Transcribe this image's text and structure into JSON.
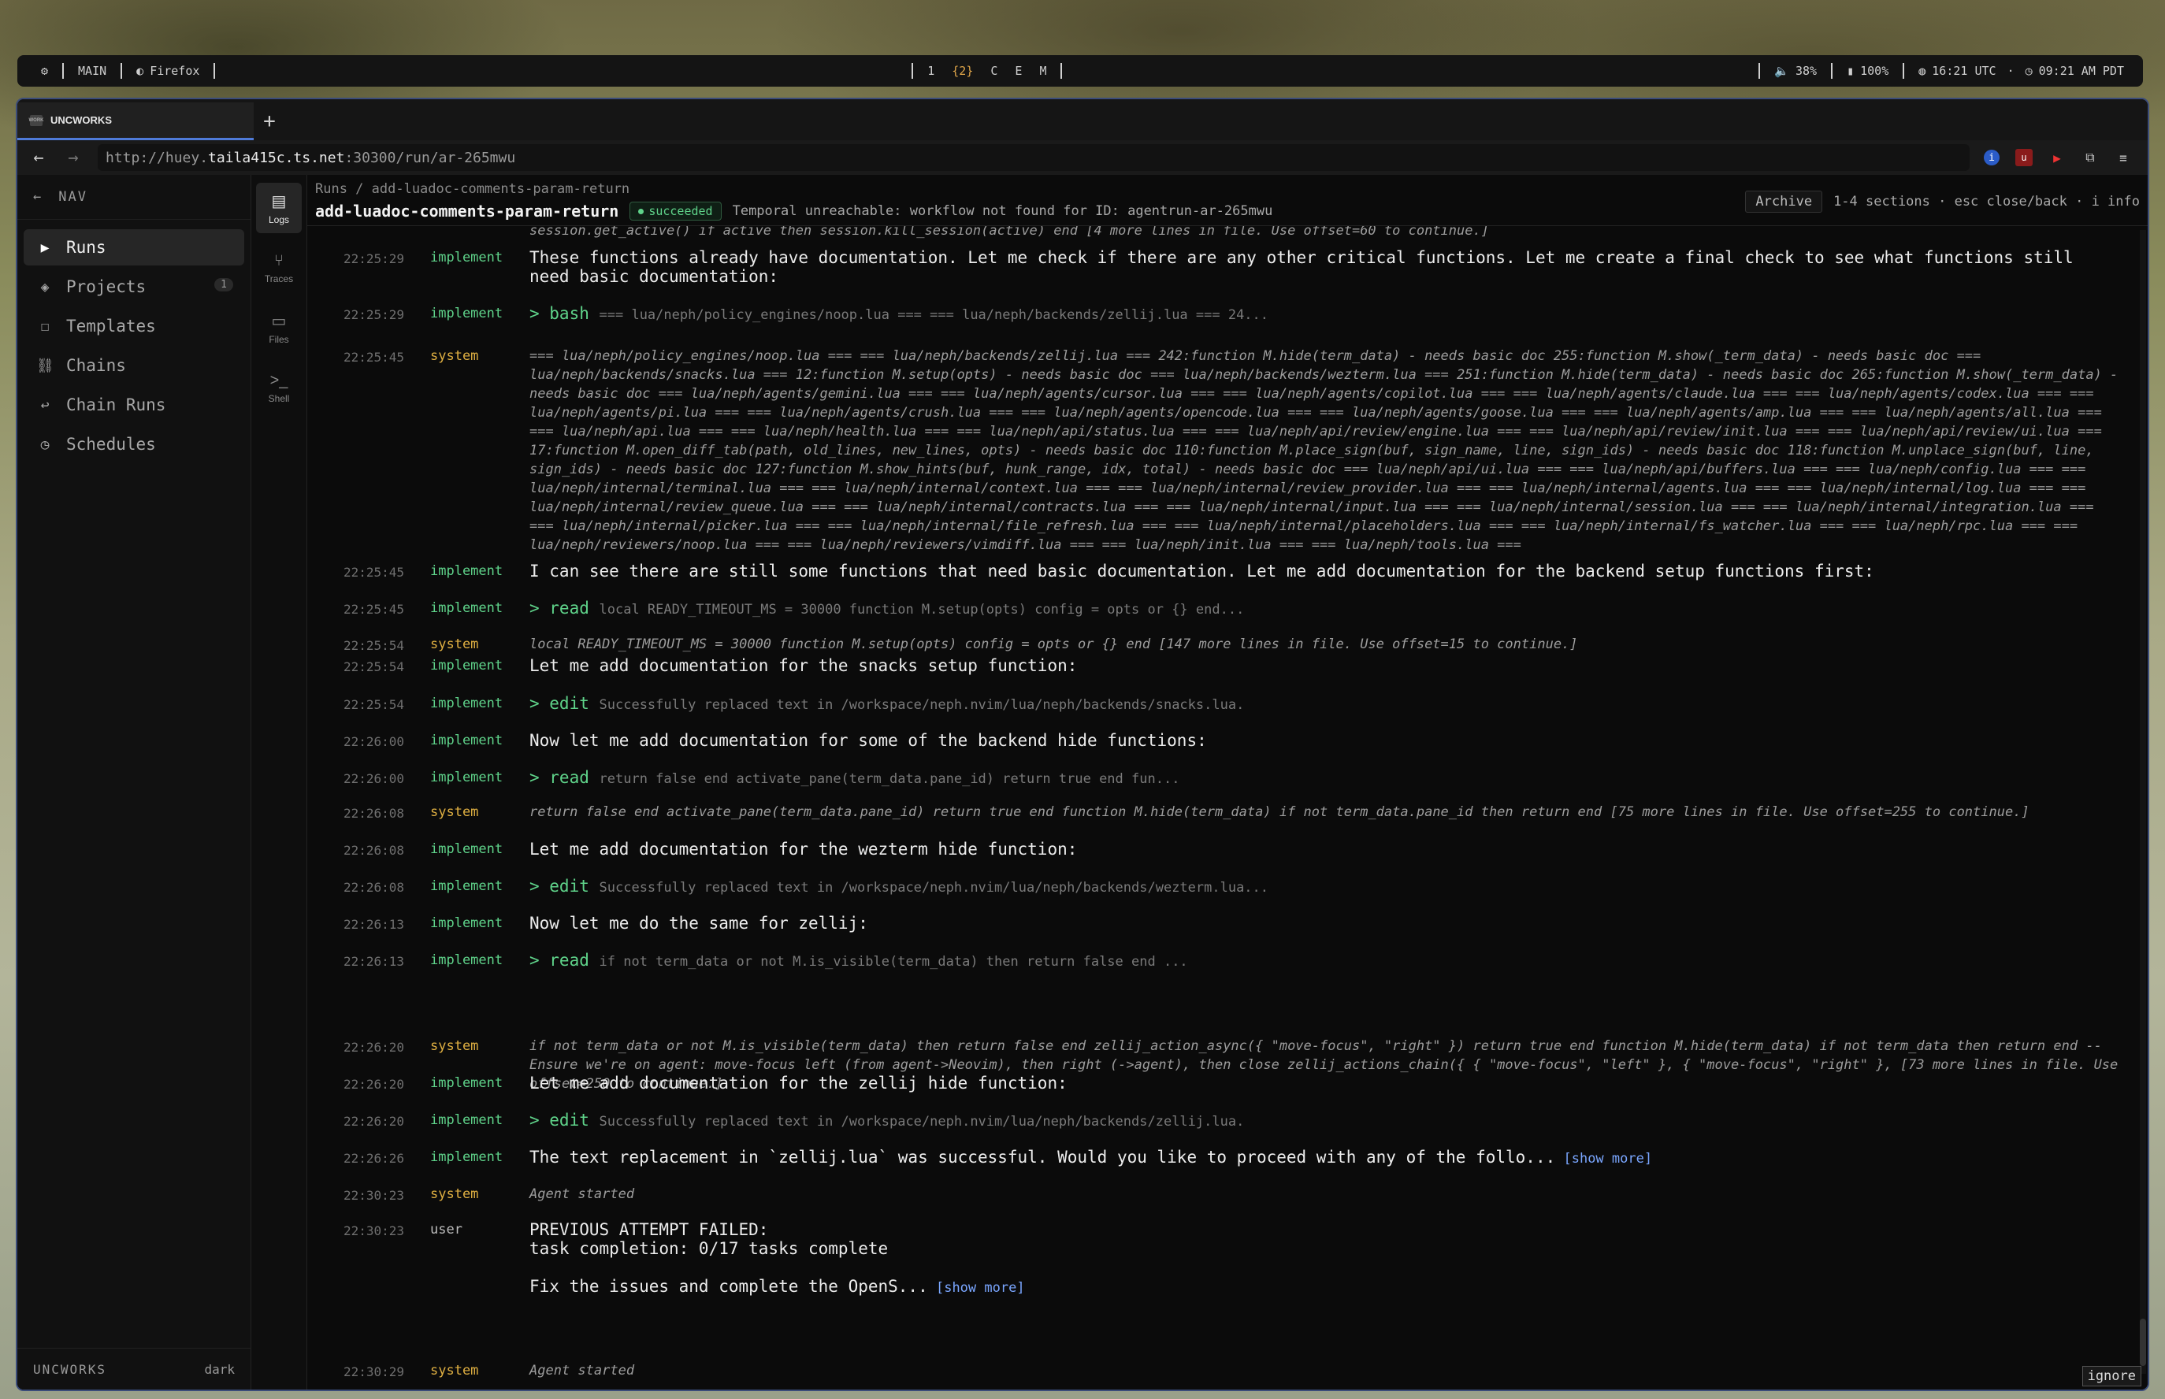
{
  "topbar": {
    "main": "MAIN",
    "browser": "Firefox",
    "workspaces": [
      "1",
      "{2}",
      "C",
      "E",
      "M"
    ],
    "volume": "38%",
    "battery": "100%",
    "utc_time": "16:21 UTC",
    "local_time": "09:21 AM PDT"
  },
  "browser": {
    "tab_title": "UNCWORKS",
    "favicon_text": "WORK",
    "new_tab": "+",
    "url_prefix": "http://huey.",
    "url_host": "taila415c.ts.net",
    "url_path": ":30300/run/ar-265mwu"
  },
  "sidebar": {
    "header": "NAV",
    "items": [
      {
        "label": "Runs",
        "icon": "play-icon",
        "active": true
      },
      {
        "label": "Projects",
        "icon": "diamond-icon",
        "badge": "1"
      },
      {
        "label": "Templates",
        "icon": "square-icon"
      },
      {
        "label": "Chains",
        "icon": "chain-icon"
      },
      {
        "label": "Chain Runs",
        "icon": "return-icon"
      },
      {
        "label": "Schedules",
        "icon": "clock-icon"
      }
    ],
    "footer_brand": "UNCWORKS",
    "footer_theme": "dark"
  },
  "iconbar": {
    "items": [
      {
        "label": "Logs",
        "active": true
      },
      {
        "label": "Traces"
      },
      {
        "label": "Files"
      },
      {
        "label": "Shell"
      }
    ]
  },
  "header": {
    "breadcrumb": "Runs / add-luadoc-comments-param-return",
    "title": "add-luadoc-comments-param-return",
    "status": "succeeded",
    "warning": "Temporal unreachable: workflow not found for ID: agentrun-ar-265mwu",
    "archive": "Archive",
    "hints": "1-4 sections · esc close/back · i info"
  },
  "log": {
    "cutoff": "session.get_active() if active then session.kill_session(active) end [4 more lines in file. Use offset=60 to continue.]",
    "entries": [
      {
        "ts": "22:25:29",
        "role": "implement",
        "text": "These functions already have documentation. Let me check if there are any other critical functions. Let me create a final check to see what functions still need basic documentation:"
      },
      {
        "ts": "22:25:29",
        "role": "implement",
        "tool": "> bash",
        "desc": "=== lua/neph/policy_engines/noop.lua === === lua/neph/backends/zellij.lua === 24..."
      },
      {
        "ts": "22:25:45",
        "role": "system",
        "text": "=== lua/neph/policy_engines/noop.lua === === lua/neph/backends/zellij.lua === 242:function M.hide(term_data) - needs basic doc 255:function M.show(_term_data) - needs basic doc === lua/neph/backends/snacks.lua === 12:function M.setup(opts) - needs basic doc === lua/neph/backends/wezterm.lua === 251:function M.hide(term_data) - needs basic doc 265:function M.show(_term_data) - needs basic doc === lua/neph/agents/gemini.lua === === lua/neph/agents/cursor.lua === === lua/neph/agents/copilot.lua === === lua/neph/agents/claude.lua === === lua/neph/agents/codex.lua === === lua/neph/agents/pi.lua === === lua/neph/agents/crush.lua === === lua/neph/agents/opencode.lua === === lua/neph/agents/goose.lua === === lua/neph/agents/amp.lua === === lua/neph/agents/all.lua === === lua/neph/api.lua === === lua/neph/health.lua === === lua/neph/api/status.lua === === lua/neph/api/review/engine.lua === === lua/neph/api/review/init.lua === === lua/neph/api/review/ui.lua === 17:function M.open_diff_tab(path, old_lines, new_lines, opts) - needs basic doc 110:function M.place_sign(buf, sign_name, line, sign_ids) - needs basic doc 118:function M.unplace_sign(buf, line, sign_ids) - needs basic doc 127:function M.show_hints(buf, hunk_range, idx, total) - needs basic doc === lua/neph/api/ui.lua === === lua/neph/api/buffers.lua === === lua/neph/config.lua === === lua/neph/internal/terminal.lua === === lua/neph/internal/context.lua === === lua/neph/internal/review_provider.lua === === lua/neph/internal/agents.lua === === lua/neph/internal/log.lua === === lua/neph/internal/review_queue.lua === === lua/neph/internal/contracts.lua === === lua/neph/internal/input.lua === === lua/neph/internal/session.lua === === lua/neph/internal/integration.lua === === lua/neph/internal/picker.lua === === lua/neph/internal/file_refresh.lua === === lua/neph/internal/placeholders.lua === === lua/neph/internal/fs_watcher.lua === === lua/neph/rpc.lua === === lua/neph/reviewers/noop.lua === === lua/neph/reviewers/vimdiff.lua === === lua/neph/init.lua === === lua/neph/tools.lua ==="
      },
      {
        "ts": "22:25:45",
        "role": "implement",
        "text": "I can see there are still some functions that need basic documentation. Let me add documentation for the backend setup functions first:"
      },
      {
        "ts": "22:25:45",
        "role": "implement",
        "tool": "> read",
        "desc": "local READY_TIMEOUT_MS = 30000 function M.setup(opts) config = opts or {} end..."
      },
      {
        "ts": "22:25:54",
        "role": "system",
        "text": "local READY_TIMEOUT_MS = 30000 function M.setup(opts) config = opts or {} end [147 more lines in file. Use offset=15 to continue.]"
      },
      {
        "ts": "22:25:54",
        "role": "implement",
        "text": "Let me add documentation for the snacks setup function:"
      },
      {
        "ts": "22:25:54",
        "role": "implement",
        "tool": "> edit",
        "desc": "Successfully replaced text in /workspace/neph.nvim/lua/neph/backends/snacks.lua."
      },
      {
        "ts": "22:26:00",
        "role": "implement",
        "text": "Now let me add documentation for some of the backend hide functions:"
      },
      {
        "ts": "22:26:00",
        "role": "implement",
        "tool": "> read",
        "desc": "return false end activate_pane(term_data.pane_id) return true end fun..."
      },
      {
        "ts": "22:26:08",
        "role": "system",
        "text": "return false end activate_pane(term_data.pane_id) return true end function M.hide(term_data) if not term_data.pane_id then return end [75 more lines in file. Use offset=255 to continue.]"
      },
      {
        "ts": "22:26:08",
        "role": "implement",
        "text": "Let me add documentation for the wezterm hide function:"
      },
      {
        "ts": "22:26:08",
        "role": "implement",
        "tool": "> edit",
        "desc": "Successfully replaced text in /workspace/neph.nvim/lua/neph/backends/wezterm.lua..."
      },
      {
        "ts": "22:26:13",
        "role": "implement",
        "text": "Now let me do the same for zellij:"
      },
      {
        "ts": "22:26:13",
        "role": "implement",
        "tool": "> read",
        "desc": "if not term_data or not M.is_visible(term_data) then return false end ..."
      },
      {
        "ts": "22:26:20",
        "role": "system",
        "text": "if not term_data or not M.is_visible(term_data) then return false end zellij_action_async({ \"move-focus\", \"right\" }) return true end function M.hide(term_data) if not term_data then return end -- Ensure we're on agent: move-focus left (from agent->Neovim), then right (->agent), then close zellij_actions_chain({ { \"move-focus\", \"left\" }, { \"move-focus\", \"right\" }, [73 more lines in file. Use offset=250 to continue.]"
      },
      {
        "ts": "22:26:20",
        "role": "implement",
        "text": "Let me add documentation for the zellij hide function:"
      },
      {
        "ts": "22:26:20",
        "role": "implement",
        "tool": "> edit",
        "desc": "Successfully replaced text in /workspace/neph.nvim/lua/neph/backends/zellij.lua."
      },
      {
        "ts": "22:26:26",
        "role": "implement",
        "text": "The text replacement in `zellij.lua` was successful. Would you like to proceed with any of the follo...",
        "more": "[show more]"
      },
      {
        "ts": "22:30:23",
        "role": "system",
        "text": "Agent started"
      },
      {
        "ts": "22:30:23",
        "role": "user",
        "text": "PREVIOUS ATTEMPT FAILED:\ntask completion: 0/17 tasks complete\n\nFix the issues and complete the OpenS...",
        "more": "[show more]"
      },
      {
        "ts": "22:30:29",
        "role": "system",
        "text": "Agent started"
      }
    ]
  },
  "ignore_button": "ignore",
  "colors": {
    "accent": "#4f7bd9",
    "implement": "#5fd38a",
    "system": "#e0b042",
    "link": "#7aa6ff"
  }
}
